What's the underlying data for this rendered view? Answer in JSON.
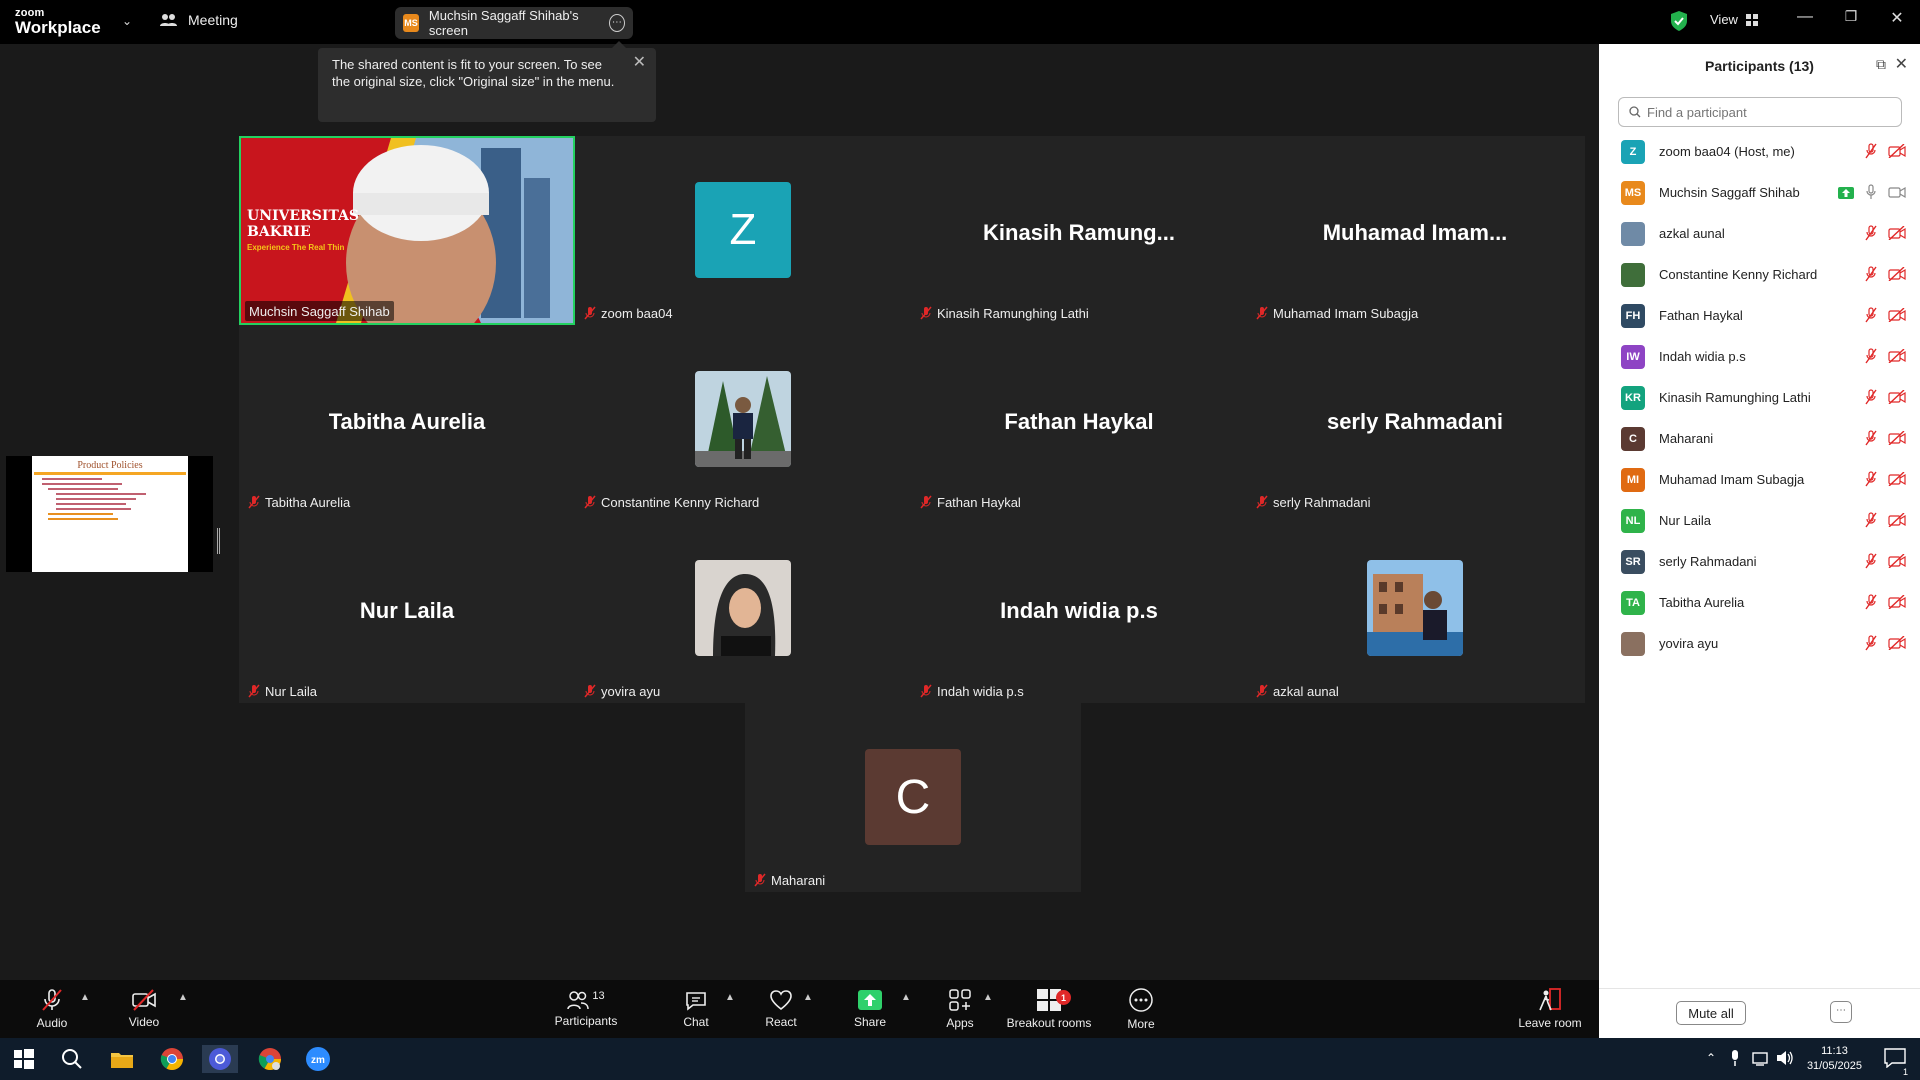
{
  "window": {
    "brand_line1": "zoom",
    "brand_line2": "Workplace",
    "meeting_label": "Meeting",
    "share_pill_avatar": "MS",
    "share_pill_label": "Muchsin Saggaff Shihab's screen",
    "view_label": "View"
  },
  "tooltip": {
    "text": "The shared content is fit to your screen. To see the original size, click \"Original size\" in the menu."
  },
  "slide_thumb": {
    "title": "Product Policies"
  },
  "tiles": [
    {
      "name": "Muchsin Saggaff Shihab",
      "big": "",
      "avatar": "video",
      "muted": false
    },
    {
      "name": "zoom baa04",
      "big": "",
      "avatar": "Z",
      "avatar_color": "#1aa3b5",
      "muted": true
    },
    {
      "name": "Kinasih Ramunghing Lathi",
      "big": "Kinasih  Ramung...",
      "avatar": "",
      "muted": true
    },
    {
      "name": "Muhamad Imam Subagja",
      "big": "Muhamad  Imam...",
      "avatar": "",
      "muted": true
    },
    {
      "name": "Tabitha Aurelia",
      "big": "Tabitha Aurelia",
      "avatar": "",
      "muted": true
    },
    {
      "name": "Constantine Kenny Richard",
      "big": "",
      "avatar": "photo-outdoor",
      "muted": true
    },
    {
      "name": "Fathan Haykal",
      "big": "Fathan Haykal",
      "avatar": "",
      "muted": true
    },
    {
      "name": "serly Rahmadani",
      "big": "serly Rahmadani",
      "avatar": "",
      "muted": true
    },
    {
      "name": "Nur Laila",
      "big": "Nur Laila",
      "avatar": "",
      "muted": true
    },
    {
      "name": "yovira ayu",
      "big": "",
      "avatar": "photo-hijab",
      "muted": true
    },
    {
      "name": "Indah widia p.s",
      "big": "Indah widia p.s",
      "avatar": "",
      "muted": true
    },
    {
      "name": "azkal aunal",
      "big": "",
      "avatar": "photo-building",
      "muted": true
    },
    {
      "name": "Maharani",
      "big": "",
      "avatar": "C",
      "avatar_color": "#5b3a32",
      "muted": true
    }
  ],
  "video_overlay": {
    "line1": "UNIVERSITAS",
    "line2": "BAKRIE",
    "line3": "Experience The Real Thin"
  },
  "panel": {
    "title": "Participants (13)",
    "search_placeholder": "Find a participant",
    "mute_all": "Mute all",
    "participants": [
      {
        "name": "zoom baa04 (Host, me)",
        "initials": "Z",
        "color": "#1aa3b5"
      },
      {
        "name": "Muchsin Saggaff Shihab",
        "initials": "MS",
        "color": "#e8891c"
      },
      {
        "name": "azkal aunal",
        "initials": "",
        "color": "#6f8aa6"
      },
      {
        "name": "Constantine Kenny Richard",
        "initials": "",
        "color": "#3f6e3a"
      },
      {
        "name": "Fathan Haykal",
        "initials": "FH",
        "color": "#2f4a63"
      },
      {
        "name": "Indah widia p.s",
        "initials": "IW",
        "color": "#8e44c4"
      },
      {
        "name": "Kinasih Ramunghing Lathi",
        "initials": "KR",
        "color": "#13a37e"
      },
      {
        "name": "Maharani",
        "initials": "C",
        "color": "#5b3a32"
      },
      {
        "name": "Muhamad Imam Subagja",
        "initials": "MI",
        "color": "#e06a12"
      },
      {
        "name": "Nur Laila",
        "initials": "NL",
        "color": "#2fb34a"
      },
      {
        "name": "serly Rahmadani",
        "initials": "SR",
        "color": "#3a4d60"
      },
      {
        "name": "Tabitha Aurelia",
        "initials": "TA",
        "color": "#2fb34a"
      },
      {
        "name": "yovira ayu",
        "initials": "",
        "color": "#8a7060"
      }
    ]
  },
  "toolbar": {
    "audio": "Audio",
    "video": "Video",
    "participants": "Participants",
    "participants_count": "13",
    "chat": "Chat",
    "react": "React",
    "share": "Share",
    "apps": "Apps",
    "breakout": "Breakout rooms",
    "breakout_badge": "1",
    "more": "More",
    "leave": "Leave room"
  },
  "taskbar": {
    "time": "11:13",
    "date": "31/05/2025",
    "notif_count": "1"
  },
  "colors": {
    "accent_green": "#23d160",
    "share_green": "#2fd06b",
    "mute_red": "#e02828"
  }
}
